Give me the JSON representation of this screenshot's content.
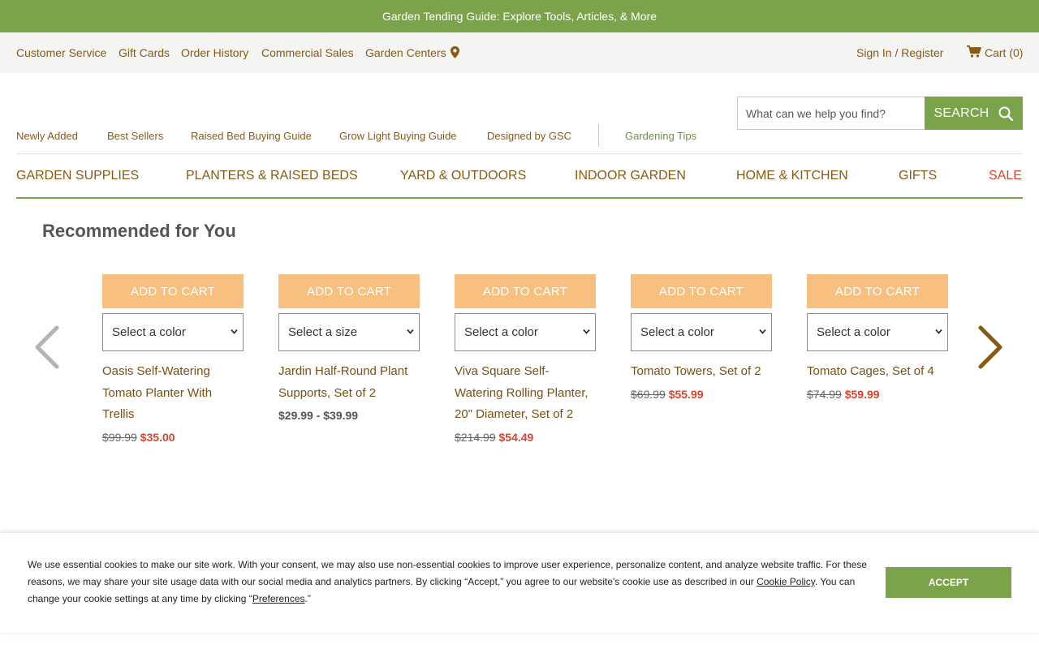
{
  "promo": {
    "text": "Garden Tending Guide: Explore Tools, Articles, & More"
  },
  "utility_nav": {
    "customer_service": "Customer Service",
    "gift_cards": "Gift Cards",
    "order_history": "Order History",
    "commercial_sales": "Commercial Sales",
    "garden_centers": "Garden Centers",
    "sign_in": "Sign In / Register",
    "cart": "Cart (0)"
  },
  "search": {
    "placeholder": "What can we help you find?",
    "button_label": "SEARCH"
  },
  "sub_nav": {
    "newly_added": "Newly Added",
    "best_sellers": "Best Sellers",
    "raised_bed_guide": "Raised Bed Buying Guide",
    "grow_light_guide": "Grow Light Buying Guide",
    "designed_by_gsc": "Designed by GSC",
    "gardening_tips": "Gardening Tips"
  },
  "main_nav": {
    "garden_supplies": "GARDEN SUPPLIES",
    "planters": "PLANTERS & RAISED BEDS",
    "yard": "YARD & OUTDOORS",
    "indoor": "INDOOR GARDEN",
    "home_kitchen": "HOME & KITCHEN",
    "gifts": "GIFTS",
    "sale": "SALE"
  },
  "recommended": {
    "title": "Recommended for You",
    "add_to_cart_label": "ADD TO CART",
    "products": [
      {
        "variant": "Select a color",
        "name": "Oasis Self-Watering Tomato Planter With Trellis",
        "old_price": "$99.99",
        "new_price": "$35.00"
      },
      {
        "variant": "Select a size",
        "name": "Jardin Half-Round Plant Supports, Set of 2",
        "price_range": "$29.99 - $39.99"
      },
      {
        "variant": "Select a color",
        "name": "Viva Square Self-Watering Rolling Planter, 20\" Diameter, Set of 2",
        "old_price": "$214.99",
        "new_price": "$54.49"
      },
      {
        "variant": "Select a color",
        "name": "Tomato Towers, Set of 2",
        "old_price": "$69.99",
        "new_price": "$55.99"
      },
      {
        "variant": "Select a color",
        "name": "Tomato Cages, Set of 4",
        "old_price": "$74.99",
        "new_price": "$59.99"
      }
    ]
  },
  "cookie": {
    "text_1": "We use essential cookies to make our site work. With your consent, we may also use non-essential cookies to improve user experience, personalize content, and analyze website traffic. For these reasons, we may share your site usage data with our social media and analytics partners. By clicking “Accept,” you agree to our website's cookie use as described in our ",
    "policy_link": "Cookie Policy",
    "text_2": ". You can change your cookie settings at any time by clicking “",
    "preferences_link": "Preferences",
    "text_3": ".”",
    "accept_label": "ACCEPT"
  },
  "colors": {
    "brand_green": "#7ba34a",
    "link_brown": "#8a5a13",
    "sale_red": "#d9452b",
    "cart_button_orange": "#f7c07f"
  }
}
